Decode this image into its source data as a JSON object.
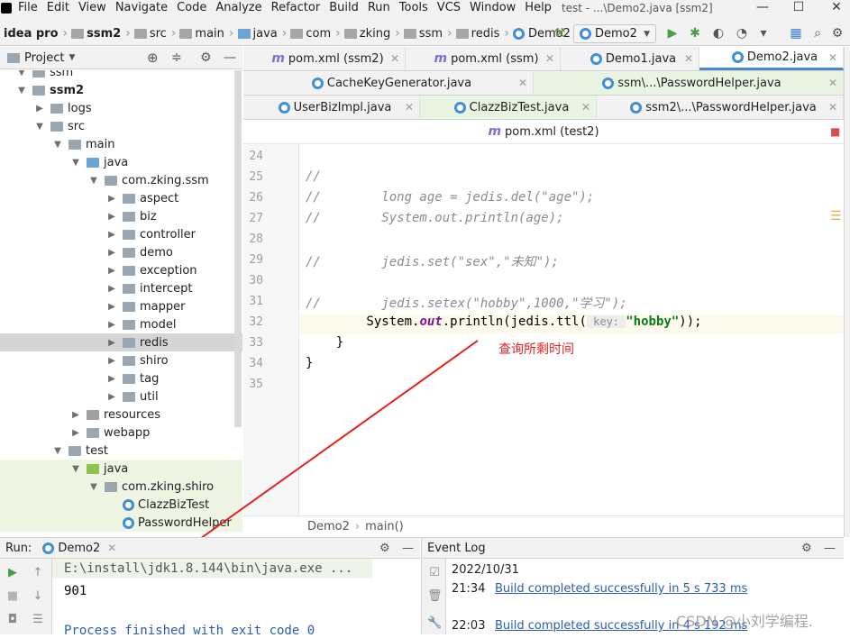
{
  "menu": {
    "items": [
      "File",
      "Edit",
      "View",
      "Navigate",
      "Code",
      "Analyze",
      "Refactor",
      "Build",
      "Run",
      "Tools",
      "VCS",
      "Window",
      "Help"
    ],
    "window_title": "test - ...\\Demo2.java [ssm2]"
  },
  "breadcrumb": {
    "items": [
      "idea pro",
      "ssm2",
      "src",
      "main",
      "java",
      "com",
      "zking",
      "ssm",
      "redis",
      "Demo2"
    ]
  },
  "run_config": {
    "selected": "Demo2"
  },
  "project_panel": {
    "title": "Project"
  },
  "tree": [
    {
      "label": "ssm",
      "depth": 1,
      "type": "folder-module",
      "arrow": "down"
    },
    {
      "label": "ssm2",
      "depth": 1,
      "type": "folder-module",
      "arrow": "down",
      "bold": true
    },
    {
      "label": "logs",
      "depth": 2,
      "type": "folder",
      "arrow": "right"
    },
    {
      "label": "src",
      "depth": 2,
      "type": "folder",
      "arrow": "down"
    },
    {
      "label": "main",
      "depth": 3,
      "type": "folder",
      "arrow": "down"
    },
    {
      "label": "java",
      "depth": 4,
      "type": "folder-src",
      "arrow": "down"
    },
    {
      "label": "com.zking.ssm",
      "depth": 5,
      "type": "package",
      "arrow": "down"
    },
    {
      "label": "aspect",
      "depth": 6,
      "type": "package",
      "arrow": "right"
    },
    {
      "label": "biz",
      "depth": 6,
      "type": "package",
      "arrow": "right"
    },
    {
      "label": "controller",
      "depth": 6,
      "type": "package",
      "arrow": "right"
    },
    {
      "label": "demo",
      "depth": 6,
      "type": "package",
      "arrow": "right"
    },
    {
      "label": "exception",
      "depth": 6,
      "type": "package",
      "arrow": "right"
    },
    {
      "label": "intercept",
      "depth": 6,
      "type": "package",
      "arrow": "right"
    },
    {
      "label": "mapper",
      "depth": 6,
      "type": "package",
      "arrow": "right"
    },
    {
      "label": "model",
      "depth": 6,
      "type": "package",
      "arrow": "right"
    },
    {
      "label": "redis",
      "depth": 6,
      "type": "package",
      "arrow": "right",
      "selected": true
    },
    {
      "label": "shiro",
      "depth": 6,
      "type": "package",
      "arrow": "right"
    },
    {
      "label": "tag",
      "depth": 6,
      "type": "package",
      "arrow": "right"
    },
    {
      "label": "util",
      "depth": 6,
      "type": "package",
      "arrow": "right"
    },
    {
      "label": "resources",
      "depth": 4,
      "type": "folder-res",
      "arrow": "right"
    },
    {
      "label": "webapp",
      "depth": 4,
      "type": "folder",
      "arrow": "right"
    },
    {
      "label": "test",
      "depth": 3,
      "type": "folder",
      "arrow": "down"
    },
    {
      "label": "java",
      "depth": 4,
      "type": "folder-test",
      "arrow": "down",
      "green": true
    },
    {
      "label": "com.zking.shiro",
      "depth": 5,
      "type": "package",
      "arrow": "down",
      "green": true
    },
    {
      "label": "ClazzBizTest",
      "depth": 6,
      "type": "class",
      "arrow": "",
      "green": true
    },
    {
      "label": "PasswordHelper",
      "depth": 6,
      "type": "class",
      "arrow": "",
      "green": true
    }
  ],
  "tabs_row1": [
    {
      "label": "pom.xml (ssm2)",
      "icon": "m"
    },
    {
      "label": "pom.xml (ssm)",
      "icon": "m"
    },
    {
      "label": "Demo1.java",
      "icon": "c"
    },
    {
      "label": "Demo2.java",
      "icon": "c",
      "active": true
    }
  ],
  "tabs_row2": [
    {
      "label": "CacheKeyGenerator.java",
      "icon": "c"
    },
    {
      "label": "ssm\\...\\PasswordHelper.java",
      "icon": "c",
      "green": true
    }
  ],
  "tabs_row3": [
    {
      "label": "UserBizImpl.java",
      "icon": "c"
    },
    {
      "label": "ClazzBizTest.java",
      "icon": "c",
      "green": true
    },
    {
      "label": "ssm2\\...\\PasswordHelper.java",
      "icon": "c"
    }
  ],
  "tabs_row4": {
    "label": "pom.xml (test2)"
  },
  "code": {
    "lines": [
      {
        "n": "24",
        "text": ""
      },
      {
        "n": "25",
        "text": "//"
      },
      {
        "n": "26",
        "text": "//        long age = jedis.del(\"age\");"
      },
      {
        "n": "27",
        "text": "//        System.out.println(age);"
      },
      {
        "n": "28",
        "text": ""
      },
      {
        "n": "29",
        "text": "//        jedis.set(\"sex\",\"未知\");"
      },
      {
        "n": "30",
        "text": ""
      },
      {
        "n": "31",
        "text": "//        jedis.setex(\"hobby\",1000,\"学习\");"
      },
      {
        "n": "32",
        "pre": "        System.",
        "out": "out",
        "mid": ".println(jedis.ttl(",
        "hint": "key:",
        "str": "\"hobby\"",
        "post": "));"
      },
      {
        "n": "33",
        "text": "    }"
      },
      {
        "n": "34",
        "text": "}"
      },
      {
        "n": "35",
        "text": ""
      }
    ],
    "annotation": "查询所剩时间"
  },
  "editor_footer": {
    "class": "Demo2",
    "method": "main()"
  },
  "run_panel": {
    "label": "Run:",
    "tab": "Demo2"
  },
  "console": {
    "command": "E:\\install\\jdk1.8.144\\bin\\java.exe ...",
    "output": "901",
    "finish": "Process finished with exit code 0"
  },
  "event_log": {
    "title": "Event Log",
    "date": "2022/10/31",
    "entries": [
      {
        "time": "21:34",
        "text": "Build completed successfully in 5 s 733 ms"
      },
      {
        "time": "22:03",
        "text": "Build completed successfully in 4 s 192 ms"
      }
    ]
  },
  "watermark": "CSDN @小刘学编程.",
  "colors": {
    "accent": "#4a88c7",
    "annotation_red": "#e52222",
    "comment": "#8c8c8c",
    "string": "#067d17",
    "keyword_out": "#871094"
  }
}
